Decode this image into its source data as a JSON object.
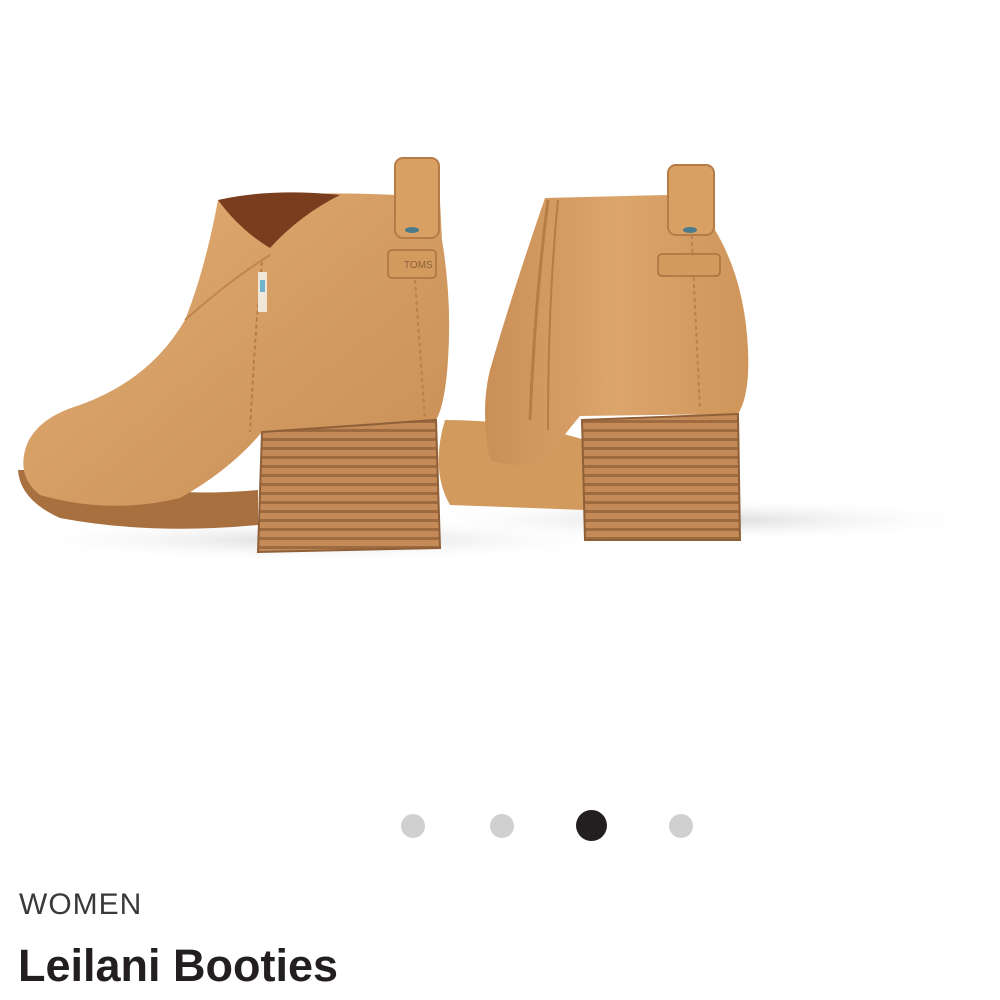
{
  "product": {
    "category": "WOMEN",
    "name": "Leilani Booties",
    "image_alt": "Leilani Booties",
    "heel_tag_text": "TOMS"
  },
  "carousel": {
    "total": 4,
    "active_index": 2
  },
  "colors": {
    "leather": "#d9a36a",
    "leather_shadow": "#c48a52",
    "heel": "#b98352",
    "dot_inactive": "#d0d0d0",
    "dot_active": "#231f20",
    "text": "#231f20"
  }
}
